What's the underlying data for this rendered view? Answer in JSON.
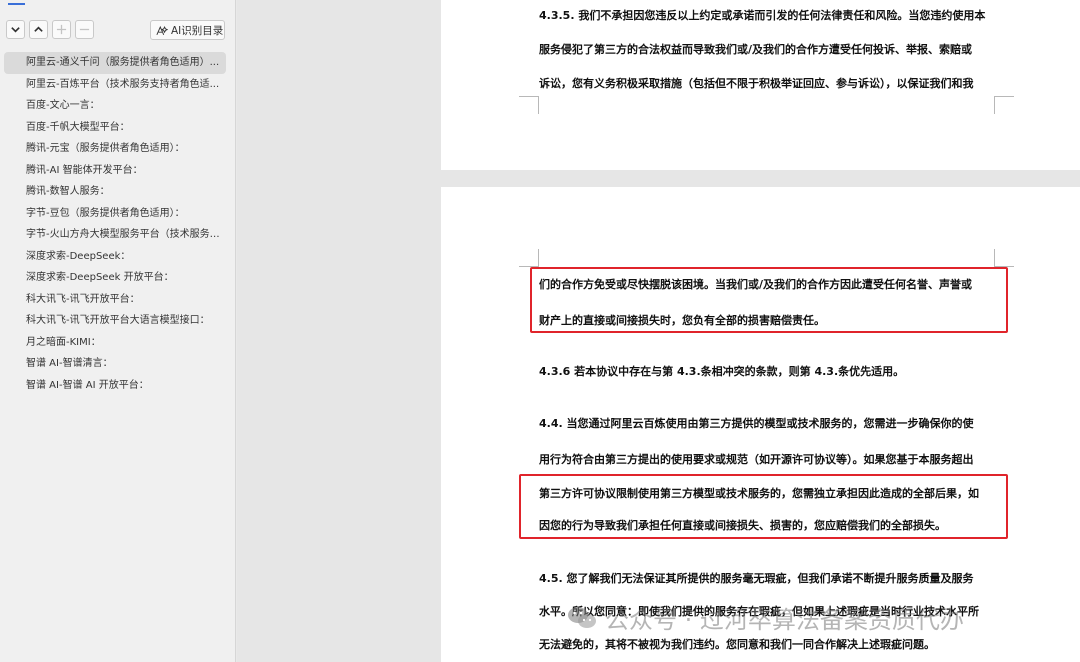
{
  "sidebar": {
    "ai_button_label": "AI识别目录",
    "items": [
      {
        "label": "阿里云-通义千问（服务提供者角色适用）..."
      },
      {
        "label": "阿里云-百炼平台（技术服务支持者角色适..."
      },
      {
        "label": "百度-文心一言："
      },
      {
        "label": "百度-千帆大模型平台："
      },
      {
        "label": "腾讯-元宝（服务提供者角色适用）："
      },
      {
        "label": "腾讯-AI 智能体开发平台："
      },
      {
        "label": "腾讯-数智人服务："
      },
      {
        "label": "字节-豆包（服务提供者角色适用）："
      },
      {
        "label": "字节-火山方舟大模型服务平台（技术服务 ..."
      },
      {
        "label": "深度求索-DeepSeek："
      },
      {
        "label": "深度求索-DeepSeek 开放平台："
      },
      {
        "label": "科大讯飞-讯飞开放平台："
      },
      {
        "label": "科大讯飞-讯飞开放平台大语言模型接口："
      },
      {
        "label": "月之暗面-KIMI："
      },
      {
        "label": "智谱 AI-智谱清言："
      },
      {
        "label": "智谱 AI-智谱 AI 开放平台："
      }
    ]
  },
  "document": {
    "page1": {
      "lines": [
        "4.3.5.  我们不承担因您违反以上约定或承诺而引发的任何法律责任和风险。当您违约使用本",
        "服务侵犯了第三方的合法权益而导致我们或/及我们的合作方遭受任何投诉、举报、索赔或",
        "诉讼，您有义务积极采取措施（包括但不限于积极举证回应、参与诉讼），以保证我们和我"
      ]
    },
    "page2": {
      "highlight1_lines": [
        "们的合作方免受或尽快摆脱该困境。当我们或/及我们的合作方因此遭受任何名誉、声誉或",
        "财产上的直接或间接损失时，您负有全部的损害赔偿责任。"
      ],
      "clause_436": "4.3.6  若本协议中存在与第 4.3.条相冲突的条款，则第 4.3.条优先适用。",
      "clause_44_lines": [
        "4.4.  当您通过阿里云百炼使用由第三方提供的模型或技术服务的，您需进一步确保你的使",
        "用行为符合由第三方提出的使用要求或规范（如开源许可协议等）。如果您基于本服务超出"
      ],
      "highlight2_lines": [
        "第三方许可协议限制使用第三方模型或技术服务的，您需独立承担因此造成的全部后果，如",
        "因您的行为导致我们承担任何直接或间接损失、损害的，您应赔偿我们的全部损失。"
      ],
      "clause_45_lines": [
        "4.5.  您了解我们无法保证其所提供的服务毫无瑕疵，但我们承诺不断提升服务质量及服务",
        "水平。所以您同意：即使我们提供的服务存在瑕疵，但如果上述瑕疵是当时行业技术水平所",
        "无法避免的，其将不被视为我们违约。您同意和我们一同合作解决上述瑕疵问题。"
      ],
      "watermark": "公众号 · 过河卒算法备案资质代办"
    }
  },
  "colors": {
    "highlight_border": "#e0242b",
    "tab_indicator": "#3a6fd8",
    "sidebar_active": "#dadada"
  }
}
